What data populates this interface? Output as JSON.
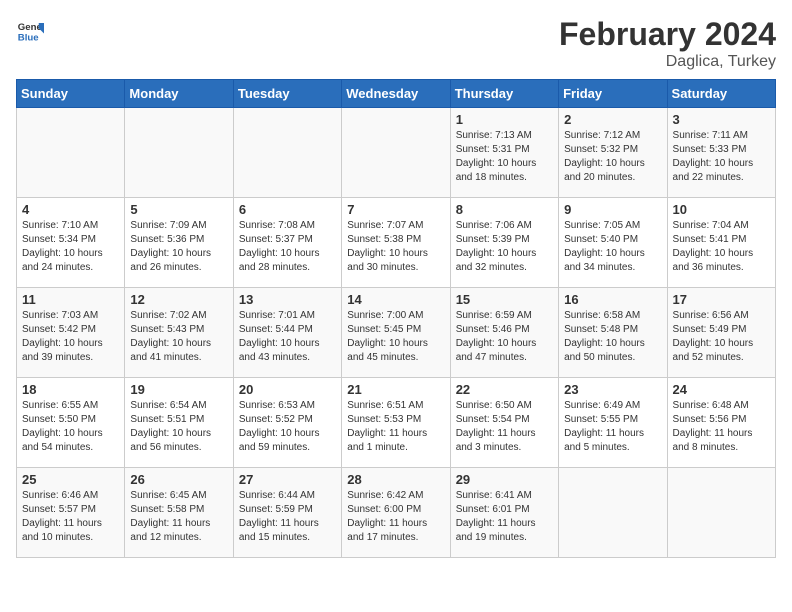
{
  "header": {
    "logo_general": "General",
    "logo_blue": "Blue",
    "title": "February 2024",
    "subtitle": "Daglica, Turkey"
  },
  "days_of_week": [
    "Sunday",
    "Monday",
    "Tuesday",
    "Wednesday",
    "Thursday",
    "Friday",
    "Saturday"
  ],
  "weeks": [
    [
      {
        "day": "",
        "info": ""
      },
      {
        "day": "",
        "info": ""
      },
      {
        "day": "",
        "info": ""
      },
      {
        "day": "",
        "info": ""
      },
      {
        "day": "1",
        "info": "Sunrise: 7:13 AM\nSunset: 5:31 PM\nDaylight: 10 hours\nand 18 minutes."
      },
      {
        "day": "2",
        "info": "Sunrise: 7:12 AM\nSunset: 5:32 PM\nDaylight: 10 hours\nand 20 minutes."
      },
      {
        "day": "3",
        "info": "Sunrise: 7:11 AM\nSunset: 5:33 PM\nDaylight: 10 hours\nand 22 minutes."
      }
    ],
    [
      {
        "day": "4",
        "info": "Sunrise: 7:10 AM\nSunset: 5:34 PM\nDaylight: 10 hours\nand 24 minutes."
      },
      {
        "day": "5",
        "info": "Sunrise: 7:09 AM\nSunset: 5:36 PM\nDaylight: 10 hours\nand 26 minutes."
      },
      {
        "day": "6",
        "info": "Sunrise: 7:08 AM\nSunset: 5:37 PM\nDaylight: 10 hours\nand 28 minutes."
      },
      {
        "day": "7",
        "info": "Sunrise: 7:07 AM\nSunset: 5:38 PM\nDaylight: 10 hours\nand 30 minutes."
      },
      {
        "day": "8",
        "info": "Sunrise: 7:06 AM\nSunset: 5:39 PM\nDaylight: 10 hours\nand 32 minutes."
      },
      {
        "day": "9",
        "info": "Sunrise: 7:05 AM\nSunset: 5:40 PM\nDaylight: 10 hours\nand 34 minutes."
      },
      {
        "day": "10",
        "info": "Sunrise: 7:04 AM\nSunset: 5:41 PM\nDaylight: 10 hours\nand 36 minutes."
      }
    ],
    [
      {
        "day": "11",
        "info": "Sunrise: 7:03 AM\nSunset: 5:42 PM\nDaylight: 10 hours\nand 39 minutes."
      },
      {
        "day": "12",
        "info": "Sunrise: 7:02 AM\nSunset: 5:43 PM\nDaylight: 10 hours\nand 41 minutes."
      },
      {
        "day": "13",
        "info": "Sunrise: 7:01 AM\nSunset: 5:44 PM\nDaylight: 10 hours\nand 43 minutes."
      },
      {
        "day": "14",
        "info": "Sunrise: 7:00 AM\nSunset: 5:45 PM\nDaylight: 10 hours\nand 45 minutes."
      },
      {
        "day": "15",
        "info": "Sunrise: 6:59 AM\nSunset: 5:46 PM\nDaylight: 10 hours\nand 47 minutes."
      },
      {
        "day": "16",
        "info": "Sunrise: 6:58 AM\nSunset: 5:48 PM\nDaylight: 10 hours\nand 50 minutes."
      },
      {
        "day": "17",
        "info": "Sunrise: 6:56 AM\nSunset: 5:49 PM\nDaylight: 10 hours\nand 52 minutes."
      }
    ],
    [
      {
        "day": "18",
        "info": "Sunrise: 6:55 AM\nSunset: 5:50 PM\nDaylight: 10 hours\nand 54 minutes."
      },
      {
        "day": "19",
        "info": "Sunrise: 6:54 AM\nSunset: 5:51 PM\nDaylight: 10 hours\nand 56 minutes."
      },
      {
        "day": "20",
        "info": "Sunrise: 6:53 AM\nSunset: 5:52 PM\nDaylight: 10 hours\nand 59 minutes."
      },
      {
        "day": "21",
        "info": "Sunrise: 6:51 AM\nSunset: 5:53 PM\nDaylight: 11 hours\nand 1 minute."
      },
      {
        "day": "22",
        "info": "Sunrise: 6:50 AM\nSunset: 5:54 PM\nDaylight: 11 hours\nand 3 minutes."
      },
      {
        "day": "23",
        "info": "Sunrise: 6:49 AM\nSunset: 5:55 PM\nDaylight: 11 hours\nand 5 minutes."
      },
      {
        "day": "24",
        "info": "Sunrise: 6:48 AM\nSunset: 5:56 PM\nDaylight: 11 hours\nand 8 minutes."
      }
    ],
    [
      {
        "day": "25",
        "info": "Sunrise: 6:46 AM\nSunset: 5:57 PM\nDaylight: 11 hours\nand 10 minutes."
      },
      {
        "day": "26",
        "info": "Sunrise: 6:45 AM\nSunset: 5:58 PM\nDaylight: 11 hours\nand 12 minutes."
      },
      {
        "day": "27",
        "info": "Sunrise: 6:44 AM\nSunset: 5:59 PM\nDaylight: 11 hours\nand 15 minutes."
      },
      {
        "day": "28",
        "info": "Sunrise: 6:42 AM\nSunset: 6:00 PM\nDaylight: 11 hours\nand 17 minutes."
      },
      {
        "day": "29",
        "info": "Sunrise: 6:41 AM\nSunset: 6:01 PM\nDaylight: 11 hours\nand 19 minutes."
      },
      {
        "day": "",
        "info": ""
      },
      {
        "day": "",
        "info": ""
      }
    ]
  ]
}
